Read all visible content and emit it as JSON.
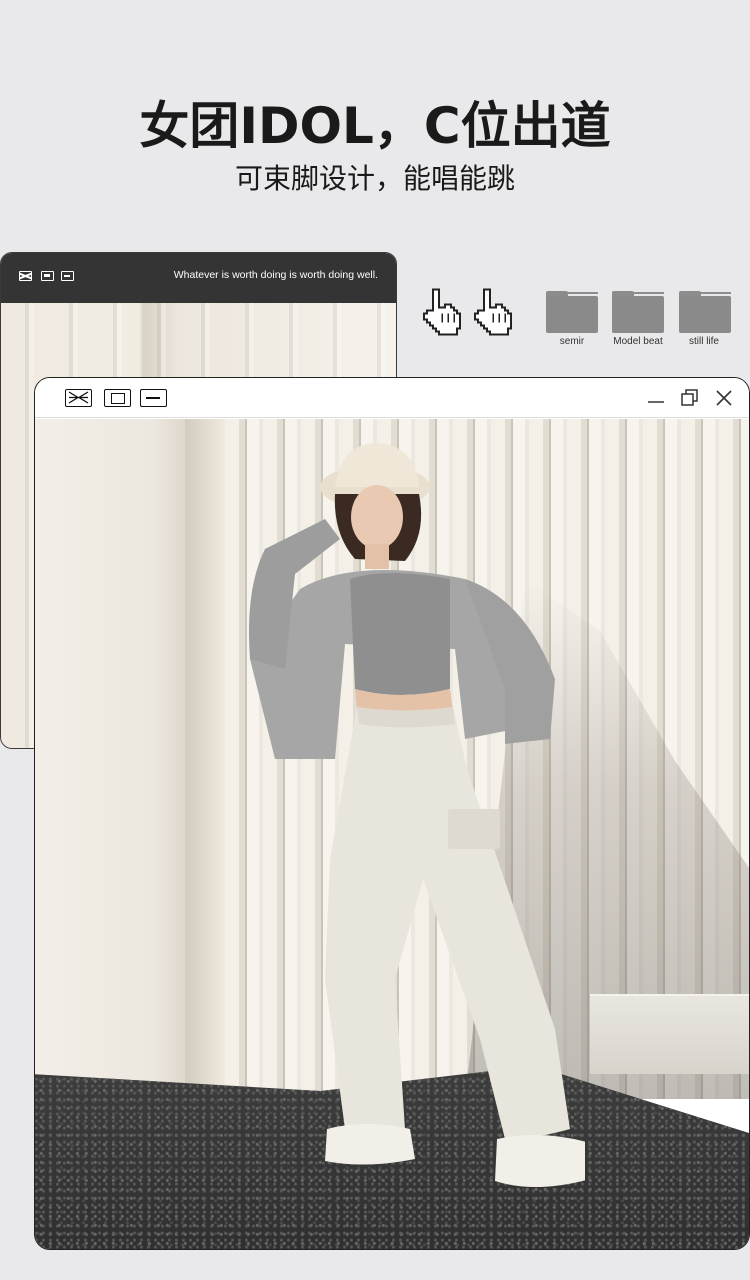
{
  "header": {
    "title": "女团IDOL，C位出道",
    "subtitle": "可束脚设计，能唱能跳"
  },
  "back_window": {
    "motto": "Whatever is worth doing is worth doing well."
  },
  "folders": [
    {
      "label": "semir"
    },
    {
      "label": "Model beat"
    },
    {
      "label": "still life"
    }
  ],
  "icons": {
    "cursor_1": "pointing-hand-cursor-icon",
    "cursor_2": "pointing-hand-cursor-icon",
    "close": "close-icon",
    "maximize": "maximize-icon",
    "minimize": "minimize-icon",
    "restore": "restore-icon"
  },
  "colors": {
    "page_bg": "#e9e9eb",
    "titlebar_dark": "#343434",
    "folder": "#8a8a8a",
    "text": "#1a1a1a"
  }
}
